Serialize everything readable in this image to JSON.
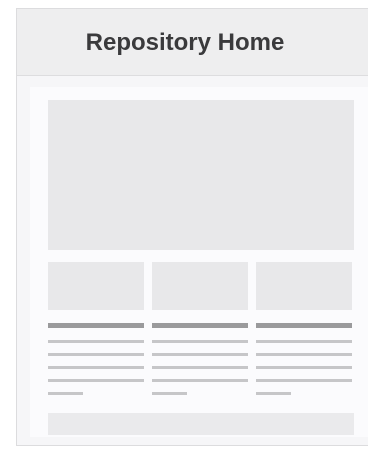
{
  "header": {
    "title": "Repository Home"
  },
  "colors": {
    "placeholder_block": "#e8e8ea",
    "heading_bar": "#9a9a9c",
    "text_line": "#c6c6c8",
    "header_bg": "#eeeeef"
  }
}
